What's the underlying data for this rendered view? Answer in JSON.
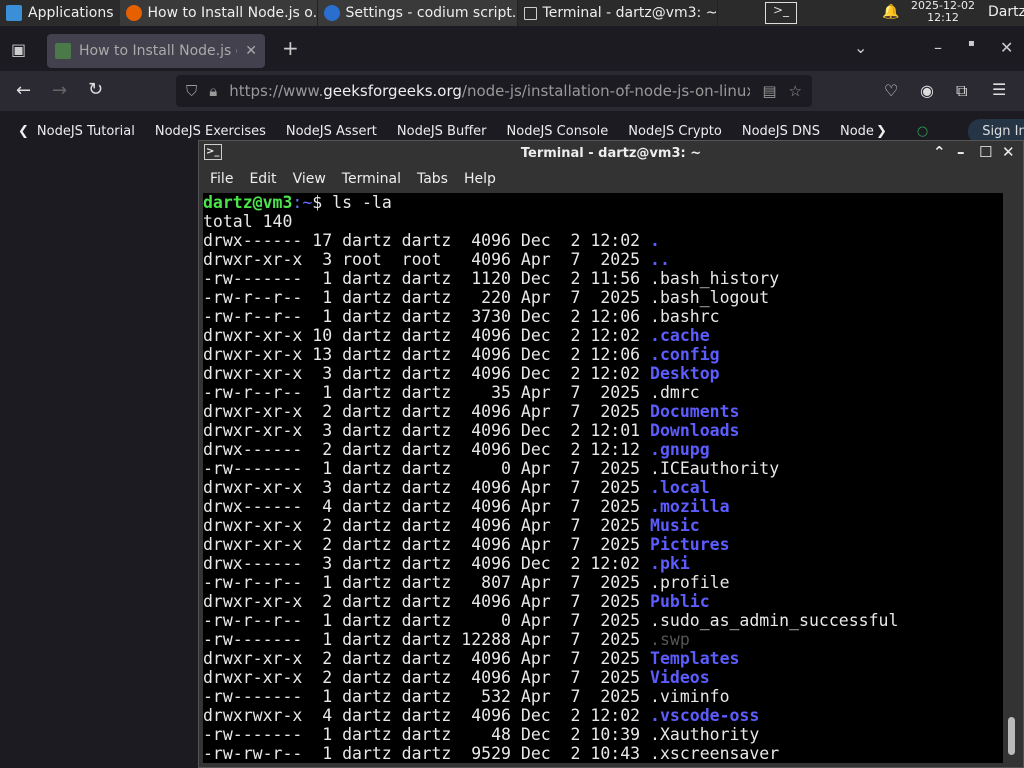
{
  "taskbar": {
    "apps_label": "Applications",
    "windows": [
      "How to Install Node.js o...",
      "Settings - codium script...",
      "Terminal - dartz@vm3: ~"
    ],
    "date": "2025-12-02",
    "time": "12:12",
    "user": "Dartz"
  },
  "browser": {
    "tab_title": "How to Install Node.js or",
    "url_prefix": "https://www.",
    "url_domain": "geeksforgeeks.org",
    "url_path": "/node-js/installation-of-node-js-on-linux/",
    "bookmarks": [
      "NodeJS Tutorial",
      "NodeJS Exercises",
      "NodeJS Assert",
      "NodeJS Buffer",
      "NodeJS Console",
      "NodeJS Crypto",
      "NodeJS DNS",
      "Node"
    ],
    "sign_in": "Sign In"
  },
  "terminal": {
    "title": "Terminal - dartz@vm3: ~",
    "menu": [
      "File",
      "Edit",
      "View",
      "Terminal",
      "Tabs",
      "Help"
    ],
    "prompt_user": "dartz@vm3",
    "prompt_path": ":~",
    "prompt_sym": "$ ",
    "command": "ls -la",
    "total": "total 140",
    "entries": [
      [
        "drwx------ 17 dartz dartz  4096 Dec  2 12:02 ",
        ".",
        "dir"
      ],
      [
        "drwxr-xr-x  3 root  root   4096 Apr  7  2025 ",
        "..",
        "dir"
      ],
      [
        "-rw-------  1 dartz dartz  1120 Dec  2 11:56 ",
        ".bash_history",
        "file"
      ],
      [
        "-rw-r--r--  1 dartz dartz   220 Apr  7  2025 ",
        ".bash_logout",
        "file"
      ],
      [
        "-rw-r--r--  1 dartz dartz  3730 Dec  2 12:06 ",
        ".bashrc",
        "file"
      ],
      [
        "drwxr-xr-x 10 dartz dartz  4096 Dec  2 12:02 ",
        ".cache",
        "dir"
      ],
      [
        "drwxr-xr-x 13 dartz dartz  4096 Dec  2 12:06 ",
        ".config",
        "dir"
      ],
      [
        "drwxr-xr-x  3 dartz dartz  4096 Dec  2 12:02 ",
        "Desktop",
        "dir"
      ],
      [
        "-rw-r--r--  1 dartz dartz    35 Apr  7  2025 ",
        ".dmrc",
        "file"
      ],
      [
        "drwxr-xr-x  2 dartz dartz  4096 Apr  7  2025 ",
        "Documents",
        "dir"
      ],
      [
        "drwxr-xr-x  3 dartz dartz  4096 Dec  2 12:01 ",
        "Downloads",
        "dir"
      ],
      [
        "drwx------  2 dartz dartz  4096 Dec  2 12:12 ",
        ".gnupg",
        "dir"
      ],
      [
        "-rw-------  1 dartz dartz     0 Apr  7  2025 ",
        ".ICEauthority",
        "file"
      ],
      [
        "drwxr-xr-x  3 dartz dartz  4096 Apr  7  2025 ",
        ".local",
        "dir"
      ],
      [
        "drwx------  4 dartz dartz  4096 Apr  7  2025 ",
        ".mozilla",
        "dir"
      ],
      [
        "drwxr-xr-x  2 dartz dartz  4096 Apr  7  2025 ",
        "Music",
        "dir"
      ],
      [
        "drwxr-xr-x  2 dartz dartz  4096 Apr  7  2025 ",
        "Pictures",
        "dir"
      ],
      [
        "drwx------  3 dartz dartz  4096 Dec  2 12:02 ",
        ".pki",
        "dir"
      ],
      [
        "-rw-r--r--  1 dartz dartz   807 Apr  7  2025 ",
        ".profile",
        "file"
      ],
      [
        "drwxr-xr-x  2 dartz dartz  4096 Apr  7  2025 ",
        "Public",
        "dir"
      ],
      [
        "-rw-r--r--  1 dartz dartz     0 Apr  7  2025 ",
        ".sudo_as_admin_successful",
        "file"
      ],
      [
        "-rw-------  1 dartz dartz 12288 Apr  7  2025 ",
        ".swp",
        "dim"
      ],
      [
        "drwxr-xr-x  2 dartz dartz  4096 Apr  7  2025 ",
        "Templates",
        "dir"
      ],
      [
        "drwxr-xr-x  2 dartz dartz  4096 Apr  7  2025 ",
        "Videos",
        "dir"
      ],
      [
        "-rw-------  1 dartz dartz   532 Apr  7  2025 ",
        ".viminfo",
        "file"
      ],
      [
        "drwxrwxr-x  4 dartz dartz  4096 Dec  2 12:02 ",
        ".vscode-oss",
        "dir"
      ],
      [
        "-rw-------  1 dartz dartz    48 Dec  2 10:39 ",
        ".Xauthority",
        "file"
      ],
      [
        "-rw-rw-r--  1 dartz dartz  9529 Dec  2 10:43 ",
        ".xscreensaver",
        "file"
      ]
    ]
  },
  "colors": {
    "dir": "#5c5cff",
    "prompt": "#4ce34c",
    "bg": "#000000"
  }
}
